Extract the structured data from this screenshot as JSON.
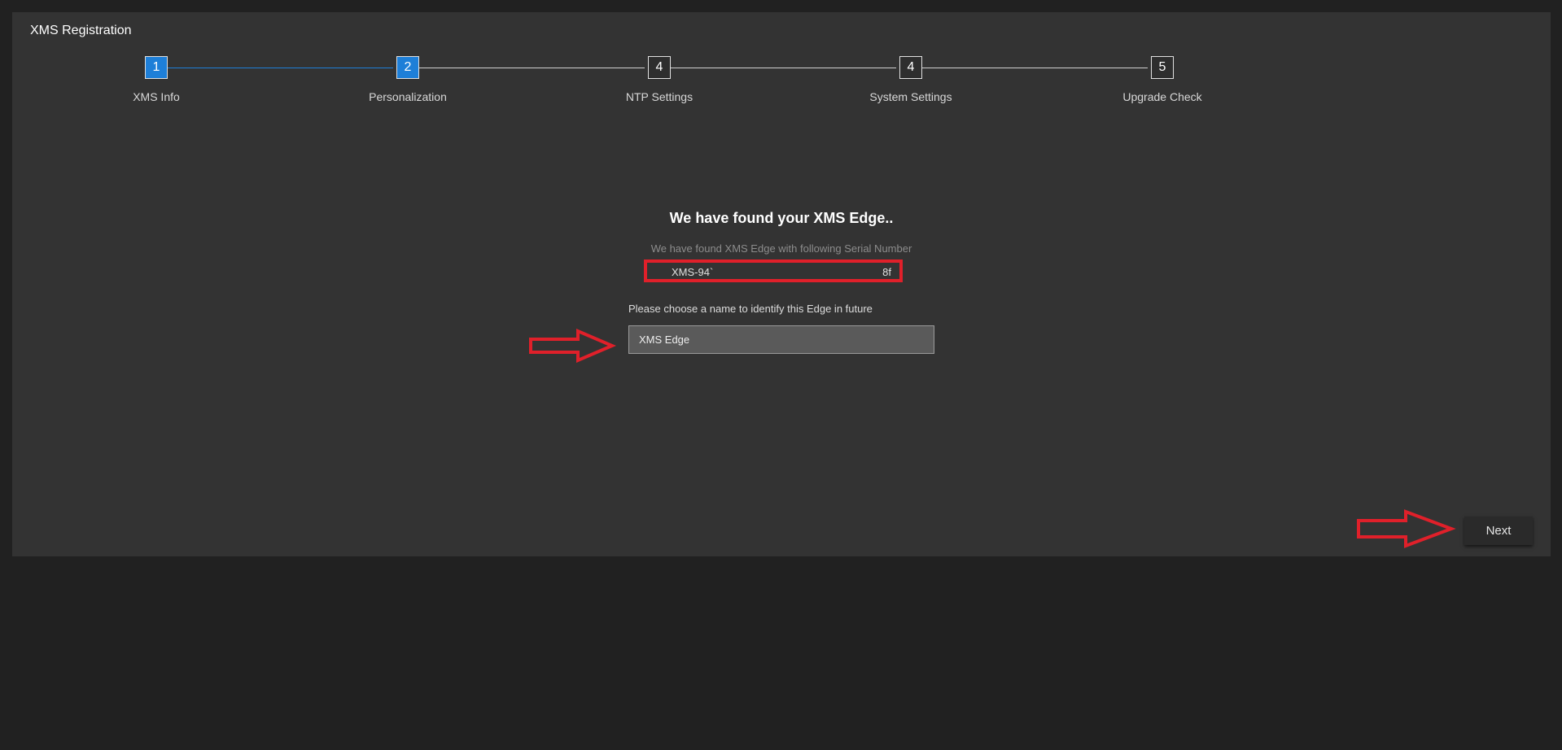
{
  "window": {
    "title": "XMS Registration"
  },
  "stepper": {
    "steps": [
      {
        "number": "1",
        "label": "XMS Info",
        "state": "completed"
      },
      {
        "number": "2",
        "label": "Personalization",
        "state": "active"
      },
      {
        "number": "4",
        "label": "NTP Settings",
        "state": "pending"
      },
      {
        "number": "4",
        "label": "System Settings",
        "state": "pending"
      },
      {
        "number": "5",
        "label": "Upgrade Check",
        "state": "pending"
      }
    ]
  },
  "main": {
    "heading": "We have found your XMS Edge..",
    "subheading": "We have found XMS Edge with following Serial Number",
    "serial_prefix": "XMS-94`",
    "serial_suffix": "8f",
    "name_label": "Please choose a name to identify this Edge in future",
    "name_value": "XMS Edge"
  },
  "footer": {
    "next_label": "Next"
  },
  "colors": {
    "accent": "#1e7fd8",
    "highlight": "#e0202a",
    "panel": "#333333",
    "background": "#212121"
  },
  "icons": {
    "annotation_arrow": "right-arrow-outline-icon"
  }
}
